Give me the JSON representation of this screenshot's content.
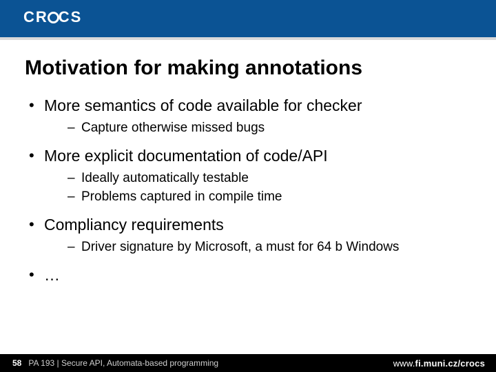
{
  "header": {
    "logo_text_prefix": "CR",
    "logo_text_suffix": "CS"
  },
  "title": "Motivation for making annotations",
  "bullets": [
    {
      "text": "More semantics of code available for checker",
      "sub": [
        "Capture otherwise missed bugs"
      ]
    },
    {
      "text": "More explicit documentation of code/API",
      "sub": [
        "Ideally automatically testable",
        "Problems captured in compile time"
      ]
    },
    {
      "text": "Compliancy requirements",
      "sub": [
        "Driver signature by Microsoft, a must for 64 b Windows"
      ]
    },
    {
      "text": "…",
      "sub": []
    }
  ],
  "footer": {
    "page_number": "58",
    "course": "PA 193 | Secure API, Automata-based programming",
    "url_prefix": "www.",
    "url_main": "fi.muni.cz/crocs"
  }
}
